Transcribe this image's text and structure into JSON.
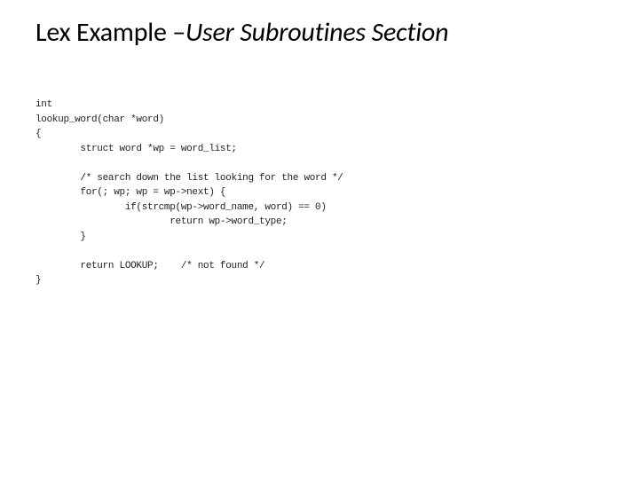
{
  "title": {
    "prefix": "Lex Example –",
    "italic": "User Subroutines Section"
  },
  "code": {
    "l01": "int",
    "l02": "lookup_word(char *word)",
    "l03": "{",
    "l04": "        struct word *wp = word_list;",
    "l05": "",
    "l06": "        /* search down the list looking for the word */",
    "l07": "        for(; wp; wp = wp->next) {",
    "l08": "                if(strcmp(wp->word_name, word) == 0)",
    "l09": "                        return wp->word_type;",
    "l10": "        }",
    "l11": "",
    "l12": "        return LOOKUP;    /* not found */",
    "l13": "}"
  }
}
